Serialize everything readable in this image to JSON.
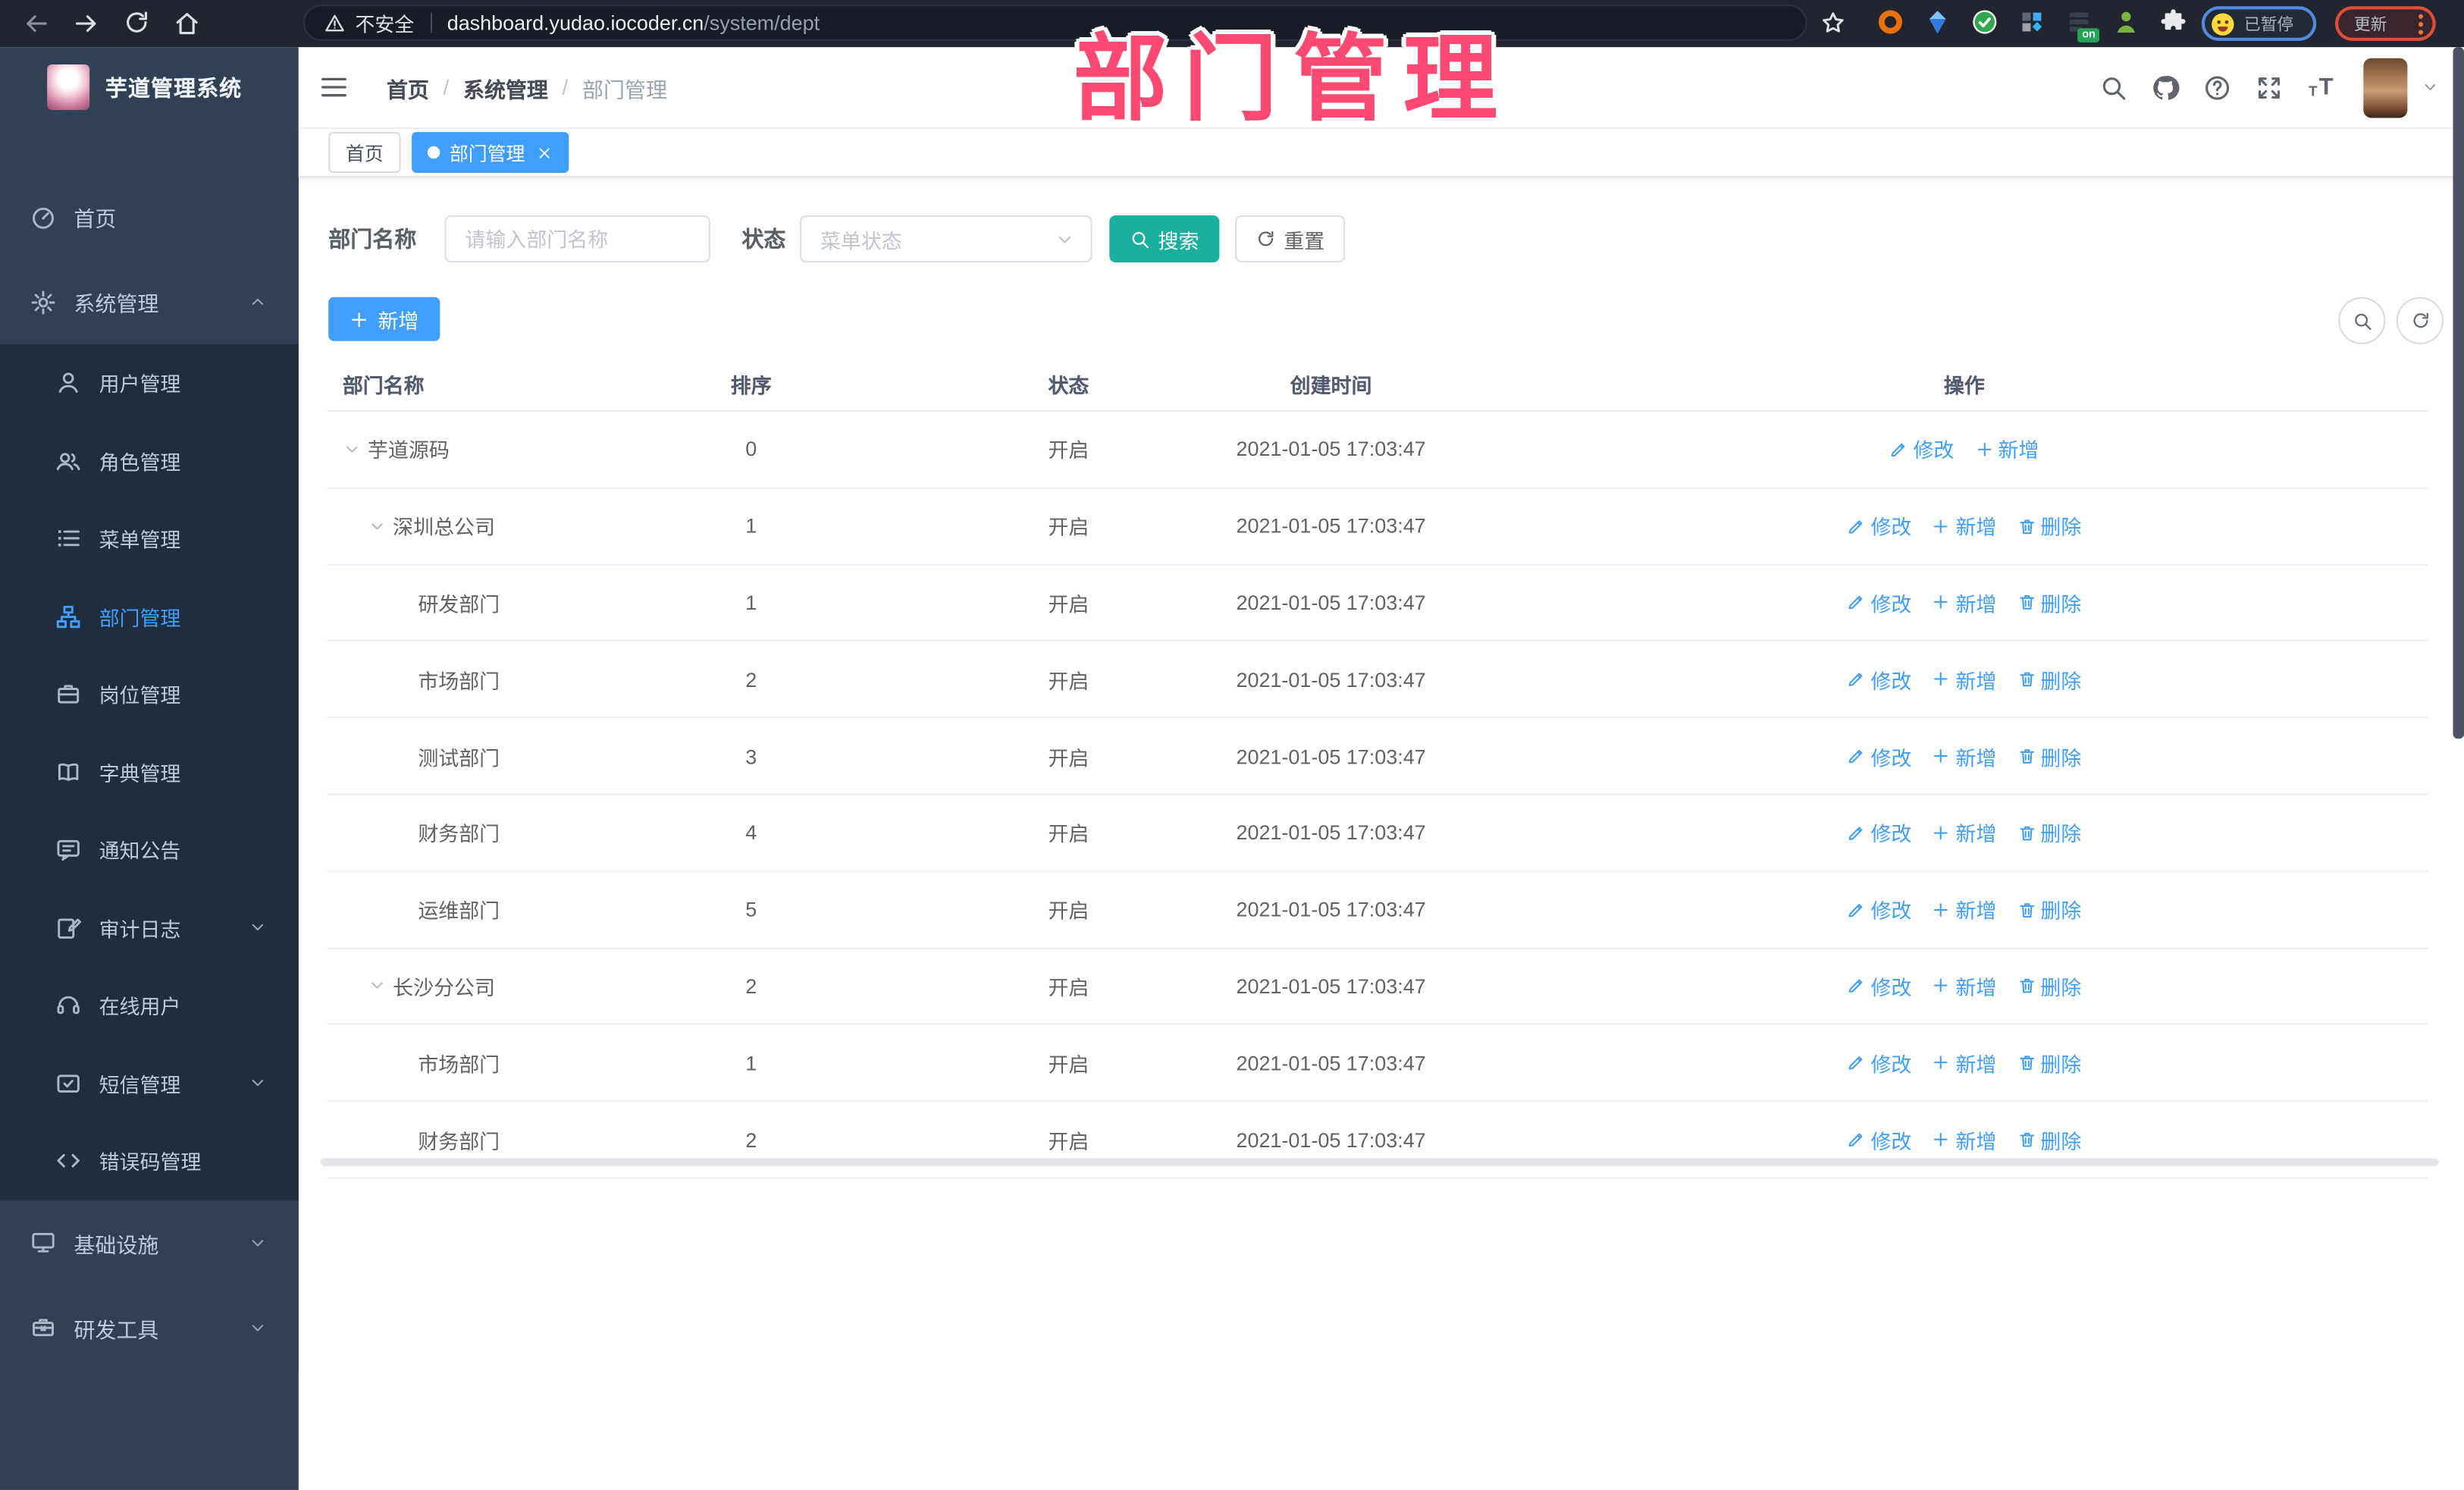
{
  "browser": {
    "security_label": "不安全",
    "url_host": "dashboard.yudao.iocoder.cn",
    "url_path": "/system/dept",
    "paused_label": "已暂停",
    "update_label": "更新",
    "extension_badge": "on",
    "nav_icons": [
      "back-icon",
      "forward-icon",
      "reload-icon",
      "home-icon"
    ],
    "extensions": [
      "extension-orange-icon",
      "extension-blue-gem-icon",
      "extension-green-check-icon",
      "extension-grid-icon",
      "extension-notes-on-icon",
      "extension-green-user-icon",
      "extensions-puzzle-icon"
    ]
  },
  "app": {
    "title": "芋道管理系统"
  },
  "sidebar": {
    "items": [
      {
        "id": "home",
        "label": "首页",
        "icon": "dashboard-icon",
        "type": "root"
      },
      {
        "id": "system",
        "label": "系统管理",
        "icon": "gear-icon",
        "type": "root",
        "caret": "up"
      },
      {
        "id": "user",
        "label": "用户管理",
        "icon": "user-icon",
        "type": "sub"
      },
      {
        "id": "role",
        "label": "角色管理",
        "icon": "users-icon",
        "type": "sub"
      },
      {
        "id": "menu",
        "label": "菜单管理",
        "icon": "menu-list-icon",
        "type": "sub"
      },
      {
        "id": "dept",
        "label": "部门管理",
        "icon": "org-tree-icon",
        "type": "sub",
        "active": true
      },
      {
        "id": "post",
        "label": "岗位管理",
        "icon": "briefcase-icon",
        "type": "sub"
      },
      {
        "id": "dict",
        "label": "字典管理",
        "icon": "book-icon",
        "type": "sub"
      },
      {
        "id": "notice",
        "label": "通知公告",
        "icon": "announcement-icon",
        "type": "sub"
      },
      {
        "id": "audit-log",
        "label": "审计日志",
        "icon": "audit-log-icon",
        "type": "sub",
        "caret": "down"
      },
      {
        "id": "online-user",
        "label": "在线用户",
        "icon": "headset-icon",
        "type": "sub"
      },
      {
        "id": "sms",
        "label": "短信管理",
        "icon": "sms-icon",
        "type": "sub",
        "caret": "down"
      },
      {
        "id": "error-code",
        "label": "错误码管理",
        "icon": "code-icon",
        "type": "sub"
      },
      {
        "id": "infra",
        "label": "基础设施",
        "icon": "monitor-icon",
        "type": "root",
        "caret": "down"
      },
      {
        "id": "dev-tools",
        "label": "研发工具",
        "icon": "toolbox-icon",
        "type": "root",
        "caret": "down"
      }
    ]
  },
  "breadcrumb": {
    "items": [
      "首页",
      "系统管理",
      "部门管理"
    ]
  },
  "header_icons": [
    "search-icon",
    "github-icon",
    "help-icon",
    "fullscreen-icon",
    "font-size-icon"
  ],
  "tags": [
    {
      "id": "home",
      "label": "首页",
      "active": false
    },
    {
      "id": "dept",
      "label": "部门管理",
      "active": true,
      "closable": true
    }
  ],
  "search": {
    "name_label": "部门名称",
    "name_placeholder": "请输入部门名称",
    "status_label": "状态",
    "status_placeholder": "菜单状态",
    "search_label": "搜索",
    "reset_label": "重置"
  },
  "toolbar": {
    "add_label": "新增"
  },
  "table": {
    "headers": [
      "部门名称",
      "排序",
      "状态",
      "创建时间",
      "操作"
    ],
    "action_labels": {
      "edit": "修改",
      "add": "新增",
      "delete": "删除"
    },
    "rows": [
      {
        "name": "芋道源码",
        "level": 0,
        "expandable": true,
        "sort": "0",
        "status": "开启",
        "time": "2021-01-05 17:03:47",
        "actions": [
          "edit",
          "add"
        ]
      },
      {
        "name": "深圳总公司",
        "level": 1,
        "expandable": true,
        "sort": "1",
        "status": "开启",
        "time": "2021-01-05 17:03:47",
        "actions": [
          "edit",
          "add",
          "delete"
        ]
      },
      {
        "name": "研发部门",
        "level": 2,
        "expandable": false,
        "sort": "1",
        "status": "开启",
        "time": "2021-01-05 17:03:47",
        "actions": [
          "edit",
          "add",
          "delete"
        ]
      },
      {
        "name": "市场部门",
        "level": 2,
        "expandable": false,
        "sort": "2",
        "status": "开启",
        "time": "2021-01-05 17:03:47",
        "actions": [
          "edit",
          "add",
          "delete"
        ]
      },
      {
        "name": "测试部门",
        "level": 2,
        "expandable": false,
        "sort": "3",
        "status": "开启",
        "time": "2021-01-05 17:03:47",
        "actions": [
          "edit",
          "add",
          "delete"
        ]
      },
      {
        "name": "财务部门",
        "level": 2,
        "expandable": false,
        "sort": "4",
        "status": "开启",
        "time": "2021-01-05 17:03:47",
        "actions": [
          "edit",
          "add",
          "delete"
        ]
      },
      {
        "name": "运维部门",
        "level": 2,
        "expandable": false,
        "sort": "5",
        "status": "开启",
        "time": "2021-01-05 17:03:47",
        "actions": [
          "edit",
          "add",
          "delete"
        ]
      },
      {
        "name": "长沙分公司",
        "level": 1,
        "expandable": true,
        "sort": "2",
        "status": "开启",
        "time": "2021-01-05 17:03:47",
        "actions": [
          "edit",
          "add",
          "delete"
        ]
      },
      {
        "name": "市场部门",
        "level": 2,
        "expandable": false,
        "sort": "1",
        "status": "开启",
        "time": "2021-01-05 17:03:47",
        "actions": [
          "edit",
          "add",
          "delete"
        ]
      },
      {
        "name": "财务部门",
        "level": 2,
        "expandable": false,
        "sort": "2",
        "status": "开启",
        "time": "2021-01-05 17:03:47",
        "actions": [
          "edit",
          "add",
          "delete"
        ]
      }
    ]
  },
  "annotation": {
    "text": "部门管理",
    "color": "#fb4a72"
  },
  "colors": {
    "accent": "#409eff",
    "search_button": "#1bafa0",
    "sidebar_bg": "#304156",
    "submenu_bg": "#1f2d3d",
    "active_text": "#409eff"
  }
}
